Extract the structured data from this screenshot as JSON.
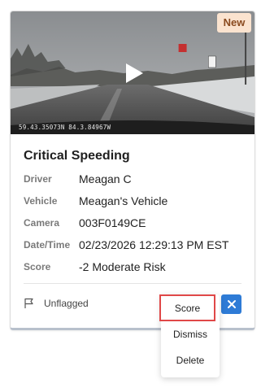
{
  "badge": "New",
  "video": {
    "gps_overlay": "59.43.35073N 84.3.84967W",
    "sign_text": "25"
  },
  "event": {
    "title": "Critical Speeding",
    "fields": [
      {
        "label": "Driver",
        "value": "Meagan C"
      },
      {
        "label": "Vehicle",
        "value": "Meagan's Vehicle"
      },
      {
        "label": "Camera",
        "value": "003F0149CE"
      },
      {
        "label": "Date/Time",
        "value": "02/23/2026 12:29:13 PM EST"
      },
      {
        "label": "Score",
        "value": "-2 Moderate Risk"
      }
    ]
  },
  "flag_status": "Unflagged",
  "menu": {
    "score": "Score",
    "dismiss": "Dismiss",
    "delete": "Delete"
  },
  "colors": {
    "primary": "#2e7bd6",
    "highlight": "#e04848",
    "badge_bg": "#fbe3cf"
  }
}
